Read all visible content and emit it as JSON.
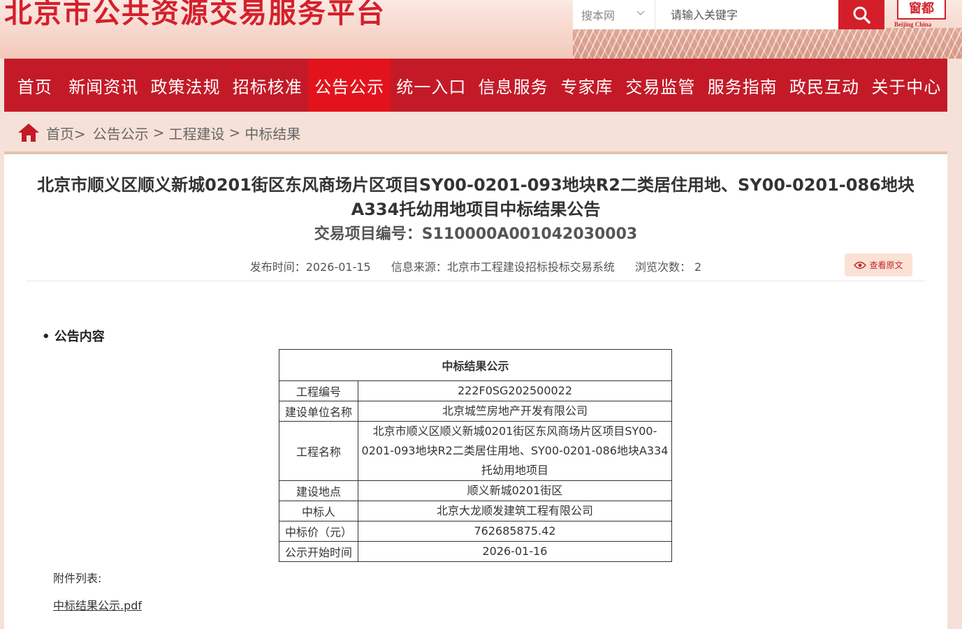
{
  "header": {
    "site_title": "北京市公共资源交易服务平台",
    "search_scope": "搜本网",
    "search_placeholder": "请输入关键字",
    "logo_seal": "窗都",
    "logo_sub": "Beijing China",
    "colors": {
      "brand_red": "#c41a28",
      "active_red": "#e2131c"
    }
  },
  "nav": {
    "items": [
      {
        "label": "首页"
      },
      {
        "label": "新闻资讯"
      },
      {
        "label": "政策法规"
      },
      {
        "label": "招标核准"
      },
      {
        "label": "公告公示",
        "active": true
      },
      {
        "label": "统一入口"
      },
      {
        "label": "信息服务"
      },
      {
        "label": "专家库"
      },
      {
        "label": "交易监管"
      },
      {
        "label": "服务指南"
      },
      {
        "label": "政民互动"
      },
      {
        "label": "关于中心"
      }
    ]
  },
  "breadcrumb": {
    "home": "首页>",
    "items": [
      "公告公示",
      "工程建设",
      "中标结果"
    ],
    "sep": ">"
  },
  "article": {
    "title": "北京市顺义区顺义新城0201街区东风商场片区项目SY00-0201-093地块R2二类居住用地、SY00-0201-086地块A334托幼用地项目中标结果公告",
    "project_no": "交易项目编号：S110000A001042030003",
    "publish_time": "发布时间：2026-01-15",
    "source": "信息来源：北京市工程建设招标投标交易系统",
    "views": "浏览次数： 2",
    "view_original": "查看原文",
    "section_title": "• 公告内容",
    "table": {
      "caption": "中标结果公示",
      "rows": [
        {
          "key": "工程编号",
          "value": "222F0SG202500022"
        },
        {
          "key": "建设单位名称",
          "value": "北京城竺房地产开发有限公司"
        },
        {
          "key": "工程名称",
          "value": "北京市顺义区顺义新城0201街区东风商场片区项目SY00-0201-093地块R2二类居住用地、SY00-0201-086地块A334托幼用地项目"
        },
        {
          "key": "建设地点",
          "value": "顺义新城0201街区"
        },
        {
          "key": "中标人",
          "value": "北京大龙顺发建筑工程有限公司"
        },
        {
          "key": "中标价（元）",
          "value": "762685875.42"
        },
        {
          "key": "公示开始时间",
          "value": "2026-01-16"
        }
      ]
    },
    "attachments_label": "附件列表:",
    "attachment": "中标结果公示.pdf"
  }
}
